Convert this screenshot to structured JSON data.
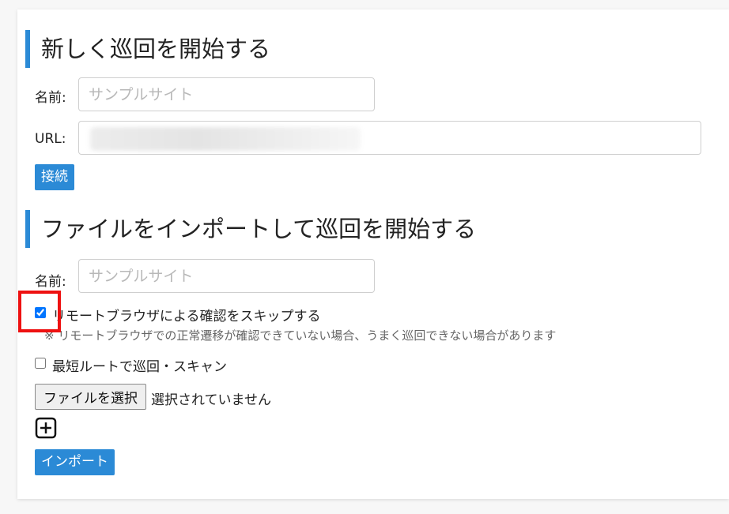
{
  "section1": {
    "title": "新しく巡回を開始する",
    "name_label": "名前:",
    "name_placeholder": "サンプルサイト",
    "url_label": "URL:",
    "url_value": "",
    "connect_button": "接続"
  },
  "section2": {
    "title": "ファイルをインポートして巡回を開始する",
    "name_label": "名前:",
    "name_placeholder": "サンプルサイト",
    "skip_remote_label": "リモートブラウザによる確認をスキップする",
    "skip_remote_checked": true,
    "skip_remote_note": "※ リモートブラウザでの正常遷移が確認できていない場合、うまく巡回できない場合があります",
    "shortest_route_label": "最短ルートで巡回・スキャン",
    "shortest_route_checked": false,
    "file_button": "ファイルを選択",
    "file_status": "選択されていません",
    "add_icon": "plus-square-icon",
    "import_button": "インポート"
  },
  "colors": {
    "accent": "#2b8ad6",
    "highlight": "#ee1111"
  }
}
